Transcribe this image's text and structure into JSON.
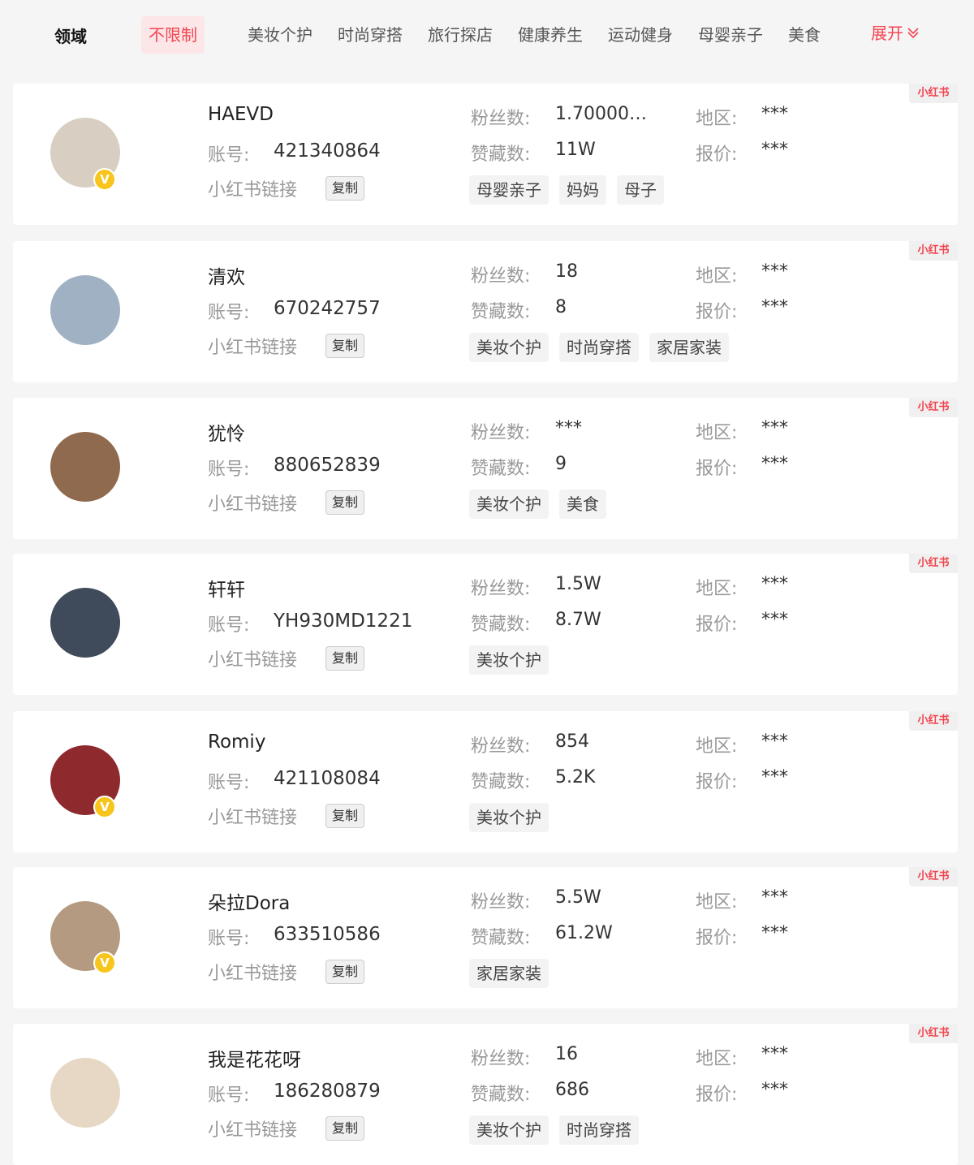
{
  "filter": {
    "label": "领域",
    "active": "不限制",
    "items": [
      "美妆个护",
      "时尚穿搭",
      "旅行探店",
      "健康养生",
      "运动健身",
      "母婴亲子",
      "美食"
    ],
    "expand": "展开"
  },
  "labels": {
    "account": "账号:",
    "link": "小红书链接",
    "copy": "复制",
    "fans": "粉丝数:",
    "likes": "赞藏数:",
    "region": "地区:",
    "price": "报价:",
    "platform": "小红书"
  },
  "cards": [
    {
      "name": "HAEVD",
      "account": "421340864",
      "fans": "1.70000…",
      "likes": "11W",
      "region": "***",
      "price": "***",
      "tags": [
        "母婴亲子",
        "妈妈",
        "母子"
      ],
      "verified": true,
      "avatar_color": "#d8cfc2"
    },
    {
      "name": "清欢",
      "account": "670242757",
      "fans": "18",
      "likes": "8",
      "region": "***",
      "price": "***",
      "tags": [
        "美妆个护",
        "时尚穿搭",
        "家居家装"
      ],
      "verified": false,
      "avatar_color": "#9fb1c3"
    },
    {
      "name": "犹怜",
      "account": "880652839",
      "fans": "***",
      "likes": "9",
      "region": "***",
      "price": "***",
      "tags": [
        "美妆个护",
        "美食"
      ],
      "verified": false,
      "avatar_color": "#8f6a4e"
    },
    {
      "name": "轩轩",
      "account": "YH930MD1221",
      "fans": "1.5W",
      "likes": "8.7W",
      "region": "***",
      "price": "***",
      "tags": [
        "美妆个护"
      ],
      "verified": false,
      "avatar_color": "#3f4a5a"
    },
    {
      "name": "Romiy",
      "account": "421108084",
      "fans": "854",
      "likes": "5.2K",
      "region": "***",
      "price": "***",
      "tags": [
        "美妆个护"
      ],
      "verified": true,
      "avatar_color": "#8e2a2e"
    },
    {
      "name": "朵拉Dora",
      "account": "633510586",
      "fans": "5.5W",
      "likes": "61.2W",
      "region": "***",
      "price": "***",
      "tags": [
        "家居家装"
      ],
      "verified": true,
      "avatar_color": "#b39a80"
    },
    {
      "name": "我是花花呀",
      "account": "186280879",
      "fans": "16",
      "likes": "686",
      "region": "***",
      "price": "***",
      "tags": [
        "美妆个护",
        "时尚穿搭"
      ],
      "verified": false,
      "avatar_color": "#e6d8c4"
    }
  ],
  "colors": {
    "accent": "#f2444f",
    "badge": "#f7c51b"
  }
}
